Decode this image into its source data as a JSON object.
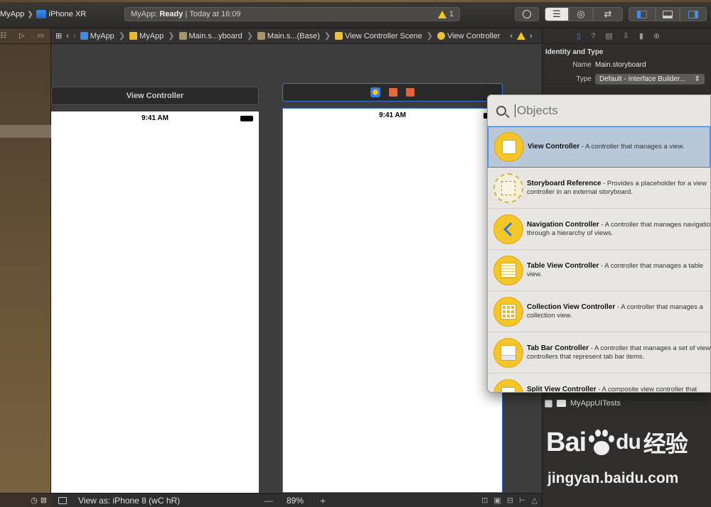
{
  "toolbar": {
    "scheme_app": "MyApp",
    "scheme_device": "iPhone XR",
    "status_app": "MyApp:",
    "status_state": "Ready",
    "status_time": "Today at 16:09",
    "warning_count": "1"
  },
  "jumpbar": {
    "crumbs": [
      "MyApp",
      "MyApp",
      "Main.s...yboard",
      "Main.s...(Base)",
      "View Controller Scene",
      "View Controller"
    ]
  },
  "canvas": {
    "scene1_title": "View Controller",
    "scene1_time": "9:41 AM",
    "scene2_time": "9:41 AM"
  },
  "bottombar": {
    "view_as": "View as: iPhone 8 (wC hR)",
    "zoom": "89%",
    "minus": "—",
    "plus": "+"
  },
  "inspector": {
    "section_title": "Identity and Type",
    "name_label": "Name",
    "name_value": "Main.storyboard",
    "type_label": "Type",
    "type_value": "Default - Interface Builder...",
    "uitests_label": "MyAppUITests"
  },
  "library": {
    "search_placeholder": "Objects",
    "items": [
      {
        "title": "View Controller",
        "desc": " - A controller that manages a view."
      },
      {
        "title": "Storyboard Reference",
        "desc": " - Provides a placeholder for a view controller in an external storyboard."
      },
      {
        "title": "Navigation Controller",
        "desc": " - A controller that manages navigation through a hierarchy of views."
      },
      {
        "title": "Table View Controller",
        "desc": " - A controller that manages a table view."
      },
      {
        "title": "Collection View Controller",
        "desc": " - A controller that manages a collection view."
      },
      {
        "title": "Tab Bar Controller",
        "desc": " - A controller that manages a set of view controllers that represent tab bar items."
      },
      {
        "title": "Split View Controller",
        "desc": " - A composite view controller that manages left and right views."
      }
    ]
  },
  "watermark": {
    "logo_text": "Bai",
    "logo_du": "du",
    "logo_cn": "经验",
    "url": "jingyan.baidu.com"
  },
  "colors": {
    "accent": "#3b8ff0",
    "library_icon": "#f5c52a",
    "warning": "#f5c518"
  }
}
